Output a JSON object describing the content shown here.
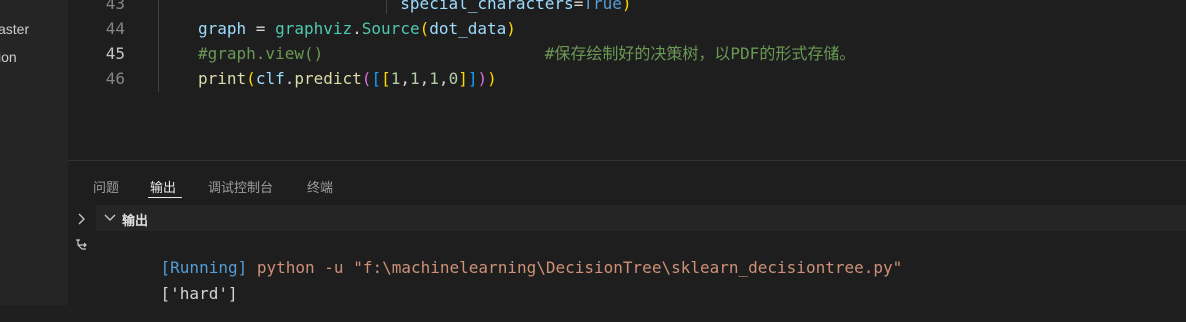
{
  "sidebar": {
    "items": [
      {
        "label": "aster"
      },
      {
        "label": "ion"
      }
    ]
  },
  "editor": {
    "lines": [
      {
        "number": "43",
        "tokens": [
          {
            "text": "                     special_characters",
            "cls": "t-var"
          },
          {
            "text": "=",
            "cls": "t-op"
          },
          {
            "text": "True",
            "cls": "t-kw"
          },
          {
            "text": ")",
            "cls": "b1"
          }
        ]
      },
      {
        "number": "44",
        "tokens": [
          {
            "text": "graph",
            "cls": "t-var"
          },
          {
            "text": " = ",
            "cls": "t-op"
          },
          {
            "text": "graphviz",
            "cls": "t-cls"
          },
          {
            "text": ".",
            "cls": "t-op"
          },
          {
            "text": "Source",
            "cls": "t-cls"
          },
          {
            "text": "(",
            "cls": "b1"
          },
          {
            "text": "dot_data",
            "cls": "t-var"
          },
          {
            "text": ")",
            "cls": "b1"
          }
        ]
      },
      {
        "number": "45",
        "active": true,
        "tokens": [
          {
            "text": "#graph.view()                       #保存绘制好的决策树，以PDF的形式存储。",
            "cls": "t-cm"
          }
        ]
      },
      {
        "number": "46",
        "tokens": [
          {
            "text": "print",
            "cls": "t-fn"
          },
          {
            "text": "(",
            "cls": "b1"
          },
          {
            "text": "clf",
            "cls": "t-var"
          },
          {
            "text": ".",
            "cls": "t-op"
          },
          {
            "text": "predict",
            "cls": "t-fn"
          },
          {
            "text": "(",
            "cls": "b2"
          },
          {
            "text": "[",
            "cls": "b3"
          },
          {
            "text": "[",
            "cls": "b1"
          },
          {
            "text": "1",
            "cls": "t-num"
          },
          {
            "text": ",",
            "cls": "t-op"
          },
          {
            "text": "1",
            "cls": "t-num"
          },
          {
            "text": ",",
            "cls": "t-op"
          },
          {
            "text": "1",
            "cls": "t-num"
          },
          {
            "text": ",",
            "cls": "t-op"
          },
          {
            "text": "0",
            "cls": "t-num"
          },
          {
            "text": "]",
            "cls": "b1"
          },
          {
            "text": "]",
            "cls": "b3"
          },
          {
            "text": ")",
            "cls": "b2"
          },
          {
            "text": ")",
            "cls": "b1"
          }
        ]
      }
    ]
  },
  "panel": {
    "tabs": [
      {
        "label": "问题"
      },
      {
        "label": "输出",
        "active": true
      },
      {
        "label": "调试控制台"
      },
      {
        "label": "终端"
      }
    ],
    "output_title": "输出",
    "output": {
      "running_tag": "[Running]",
      "command": " python -u \"f:\\machinelearning\\DecisionTree\\sklearn_decisiontree.py\"",
      "result": "['hard']"
    }
  },
  "colors": {
    "background": "#1e1e1e",
    "comment": "#6a9955",
    "keyword": "#569cd6",
    "string": "#ce9178"
  },
  "icons": [
    "chevron-right-icon",
    "chevron-down-icon",
    "filter-icon"
  ]
}
